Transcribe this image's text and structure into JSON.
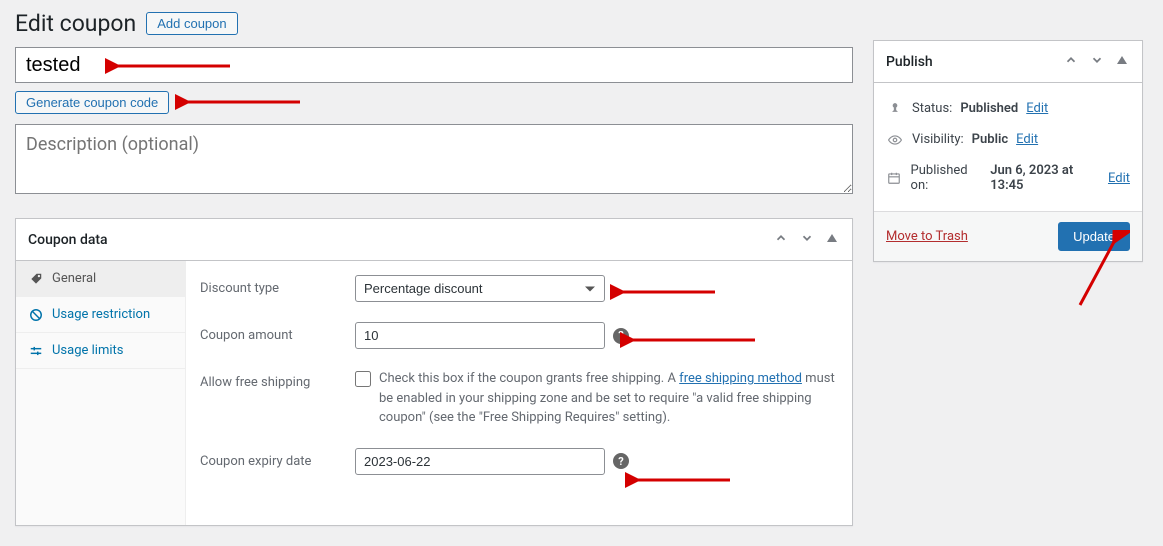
{
  "header": {
    "title": "Edit coupon",
    "add_button": "Add coupon"
  },
  "coupon": {
    "code": "tested",
    "generate_button": "Generate coupon code",
    "description_placeholder": "Description (optional)"
  },
  "coupon_data": {
    "title": "Coupon data",
    "tabs": {
      "general": "General",
      "usage_restriction": "Usage restriction",
      "usage_limits": "Usage limits"
    },
    "fields": {
      "discount_type_label": "Discount type",
      "discount_type_value": "Percentage discount",
      "coupon_amount_label": "Coupon amount",
      "coupon_amount_value": "10",
      "free_shipping_label": "Allow free shipping",
      "free_shipping_text_pre": "Check this box if the coupon grants free shipping. A ",
      "free_shipping_link": "free shipping method",
      "free_shipping_text_post": " must be enabled in your shipping zone and be set to require \"a valid free shipping coupon\" (see the \"Free Shipping Requires\" setting).",
      "expiry_label": "Coupon expiry date",
      "expiry_value": "2023-06-22"
    }
  },
  "publish": {
    "title": "Publish",
    "status_label": "Status:",
    "status_value": "Published",
    "visibility_label": "Visibility:",
    "visibility_value": "Public",
    "published_label": "Published on:",
    "published_value": "Jun 6, 2023 at 13:45",
    "edit_link": "Edit",
    "trash_link": "Move to Trash",
    "update_button": "Update"
  }
}
